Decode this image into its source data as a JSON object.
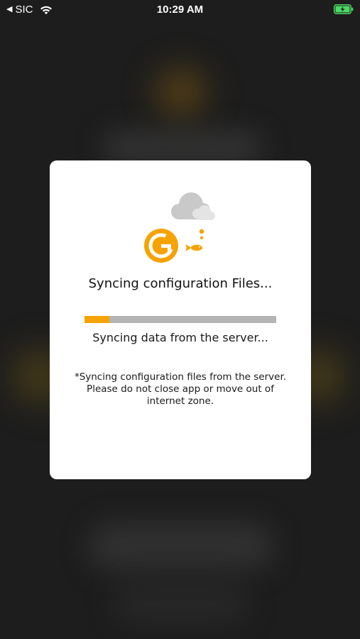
{
  "status_bar": {
    "back_glyph": "◀",
    "carrier": "SIC",
    "time": "10:29 AM",
    "icons": [
      "wifi-icon",
      "battery-charging-icon"
    ]
  },
  "dialog": {
    "title": "Syncing configuration Files...",
    "progress": {
      "fraction": 0.13,
      "fill_color": "#f5a300",
      "track_color": "#b4b4b4",
      "label": "Syncing data from the server..."
    },
    "notice_lines": [
      "*Syncing configuration files from the server.",
      "Please do not close app or move out of",
      "internet zone."
    ],
    "logo_letter": "G",
    "illustration_icons": [
      "cloud-icon",
      "logo-icon",
      "fish-icon"
    ]
  },
  "colors": {
    "accent": "#f5a300",
    "background": "#1d1d1d",
    "dialog_bg": "#ffffff",
    "battery": "#4cd964"
  }
}
